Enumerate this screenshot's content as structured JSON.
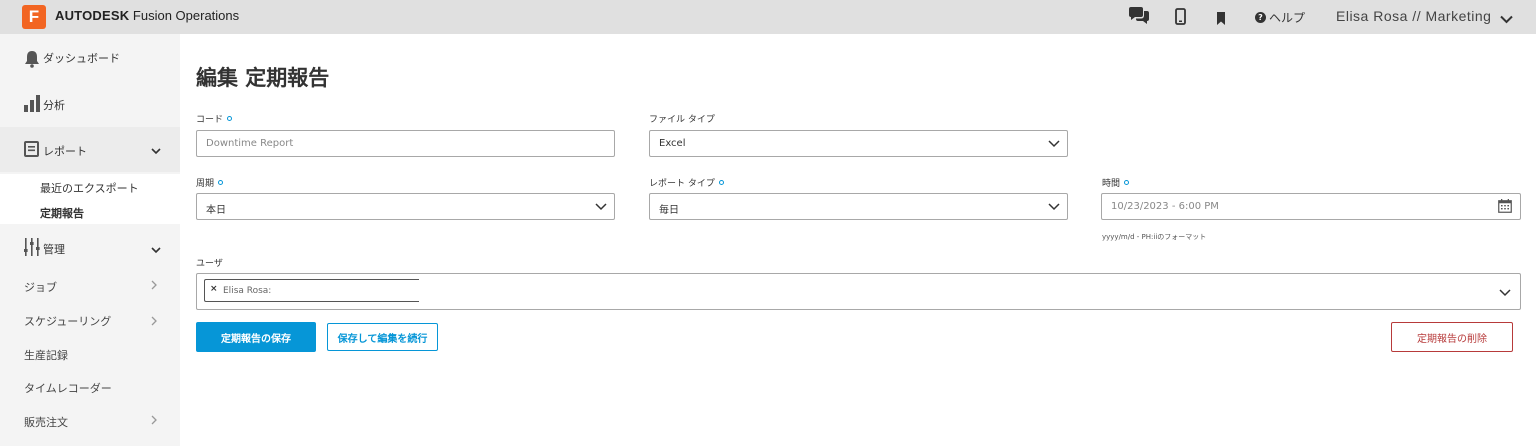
{
  "app": {
    "logo_letter": "F",
    "brand_bold": "AUTODESK",
    "brand_rest": " Fusion Operations",
    "help_label": "ヘルプ",
    "user_label": "Elisa Rosa // Marketing"
  },
  "sidebar": {
    "dashboard": "ダッシュボード",
    "analytics": "分析",
    "reports": "レポート",
    "recent_exports": "最近のエクスポート",
    "scheduled_reports": "定期報告",
    "admin": "管理",
    "jobs": "ジョブ",
    "scheduling": "スケジューリング",
    "production_records": "生産記録",
    "time_recorder": "タイムレコーダー",
    "sales_orders": "販売注文"
  },
  "form": {
    "title": "編集 定期報告",
    "code_label": "コード",
    "code_placeholder": "Downtime Report",
    "file_type_label": "ファイル タイプ",
    "file_type_value": "Excel",
    "period_label": "周期",
    "period_value": "本日",
    "report_type_label": "レポート タイプ",
    "report_type_value": "毎日",
    "time_label": "時間",
    "time_placeholder": "10/23/2023 - 6:00 PM",
    "time_hint": "yyyy/m/d - PH:iiのフォーマット",
    "users_label": "ユーザ",
    "user_tag": "Elisa Rosa:"
  },
  "buttons": {
    "save": "定期報告の保存",
    "save_continue": "保存して編集を続行",
    "delete": "定期報告の削除"
  },
  "colors": {
    "accent": "#0696d7",
    "brand": "#f26522",
    "danger": "#b73a3a"
  }
}
